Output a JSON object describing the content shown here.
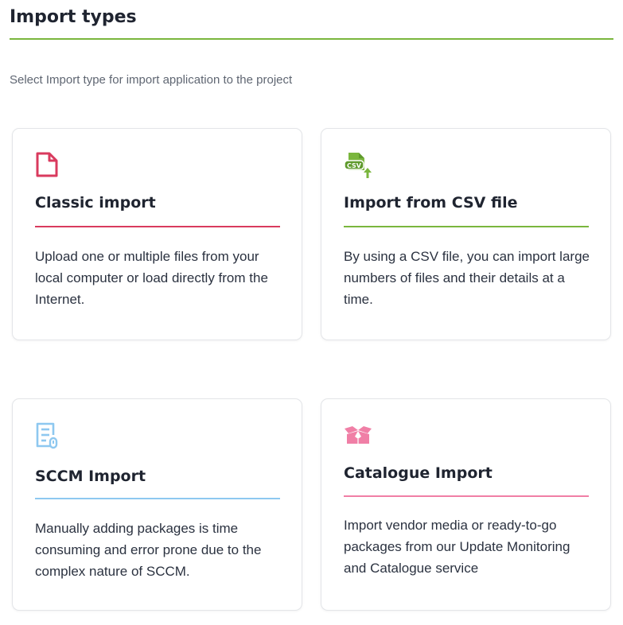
{
  "header": {
    "title": "Import types",
    "subtitle": "Select Import type for import application to the project",
    "accent_color": "#7ab63d"
  },
  "cards": [
    {
      "title": "Classic import",
      "description": "Upload one or multiple files from your local computer or load directly from the Internet.",
      "icon": "file-icon",
      "accent_color": "#d93a5e"
    },
    {
      "title": "Import from CSV file",
      "description": "By using a CSV file, you can import large numbers of files and their details at a time.",
      "icon": "csv-upload-icon",
      "icon_text": "CSV",
      "accent_color": "#7ab63d"
    },
    {
      "title": "SCCM Import",
      "description": "Manually adding packages is time consuming and error prone due to the complex nature of SCCM.",
      "icon": "sccm-icon",
      "accent_color": "#8ec8f0"
    },
    {
      "title": "Catalogue Import",
      "description": "Import vendor media or ready-to-go packages from our Update Monitoring and Catalogue service",
      "icon": "open-box-icon",
      "accent_color": "#f07fa6"
    }
  ]
}
